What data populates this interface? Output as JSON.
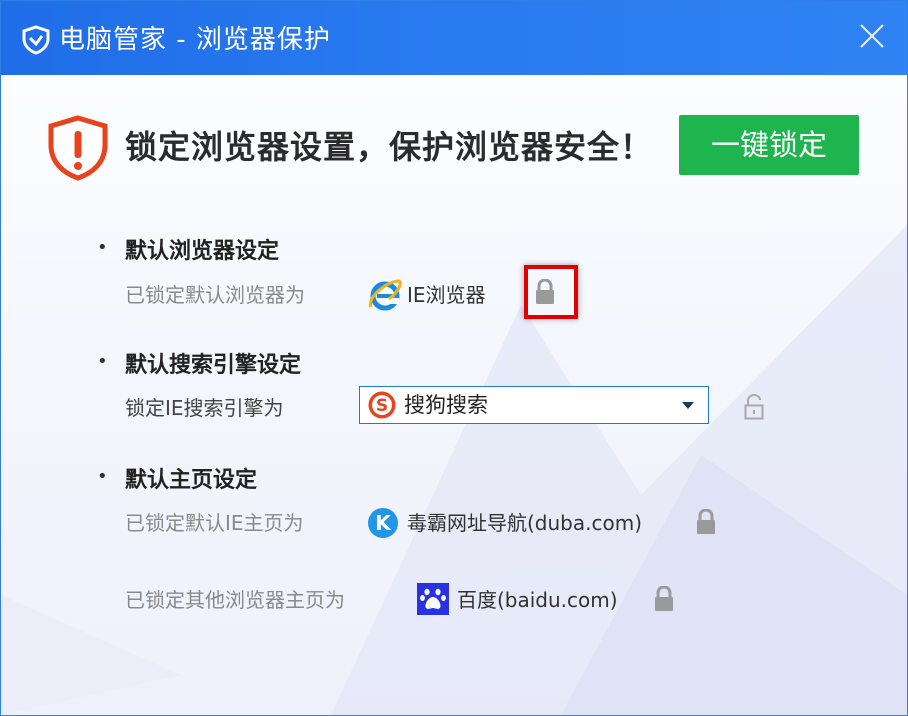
{
  "window": {
    "title": "电脑管家 - 浏览器保护"
  },
  "header": {
    "headline": "锁定浏览器设置，保护浏览器安全！",
    "lock_all_label": "一键锁定"
  },
  "sections": {
    "default_browser": {
      "title": "默认浏览器设定",
      "label": "已锁定默认浏览器为",
      "value": "IE浏览器",
      "locked": true
    },
    "search_engine": {
      "title": "默认搜索引擎设定",
      "label": "锁定IE搜索引擎为",
      "selected": "搜狗搜索",
      "locked": false
    },
    "homepage": {
      "title": "默认主页设定",
      "ie_label": "已锁定默认IE主页为",
      "ie_value": "毒霸网址导航(duba.com)",
      "ie_locked": true,
      "other_label": "已锁定其他浏览器主页为",
      "other_value": "百度(baidu.com)",
      "other_locked": true
    }
  },
  "colors": {
    "titlebar": "#2a7af0",
    "accent_green": "#1eb54f",
    "warning_red": "#e8431d",
    "highlight": "#e00000",
    "lock_gray": "#9a9a9a"
  },
  "icons": [
    "shield-logo-icon",
    "close-icon",
    "warning-shield-icon",
    "ie-icon",
    "sogou-icon",
    "duba-icon",
    "baidu-icon",
    "lock-icon",
    "unlock-icon",
    "dropdown-arrow-icon"
  ]
}
